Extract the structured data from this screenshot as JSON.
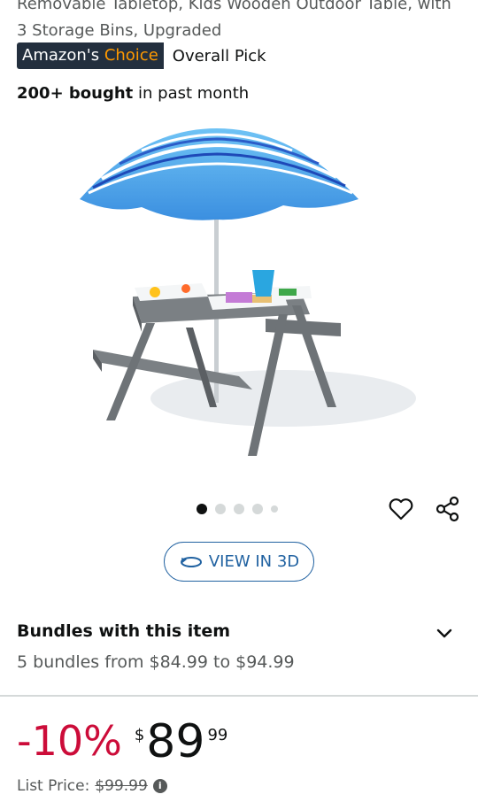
{
  "product": {
    "title_line1": "Removable Tabletop, Kids Wooden Outdoor Table, with",
    "title_line2": "3 Storage Bins, Upgraded"
  },
  "badges": {
    "choice_prefix": "Amazon's",
    "choice_suffix": "Choice",
    "overall_pick": "Overall Pick"
  },
  "social_proof": {
    "bought_bold": "200+ bought",
    "bought_rest": " in past month"
  },
  "gallery": {
    "image_count": 5,
    "active_index": 0
  },
  "actions": {
    "wishlist_icon": "heart-icon",
    "share_icon": "share-icon",
    "view3d_label": "VIEW IN 3D"
  },
  "bundles": {
    "title": "Bundles with this item",
    "subtitle": "5 bundles from $84.99 to $94.99"
  },
  "pricing": {
    "discount": "-10%",
    "currency": "$",
    "whole": "89",
    "fraction": "99",
    "list_label": "List Price:",
    "list_value": "$99.99"
  },
  "colors": {
    "deal_red": "#cc0c39",
    "link_blue": "#2162a1",
    "badge_bg": "#232f3e",
    "badge_accent": "#ff9900"
  }
}
